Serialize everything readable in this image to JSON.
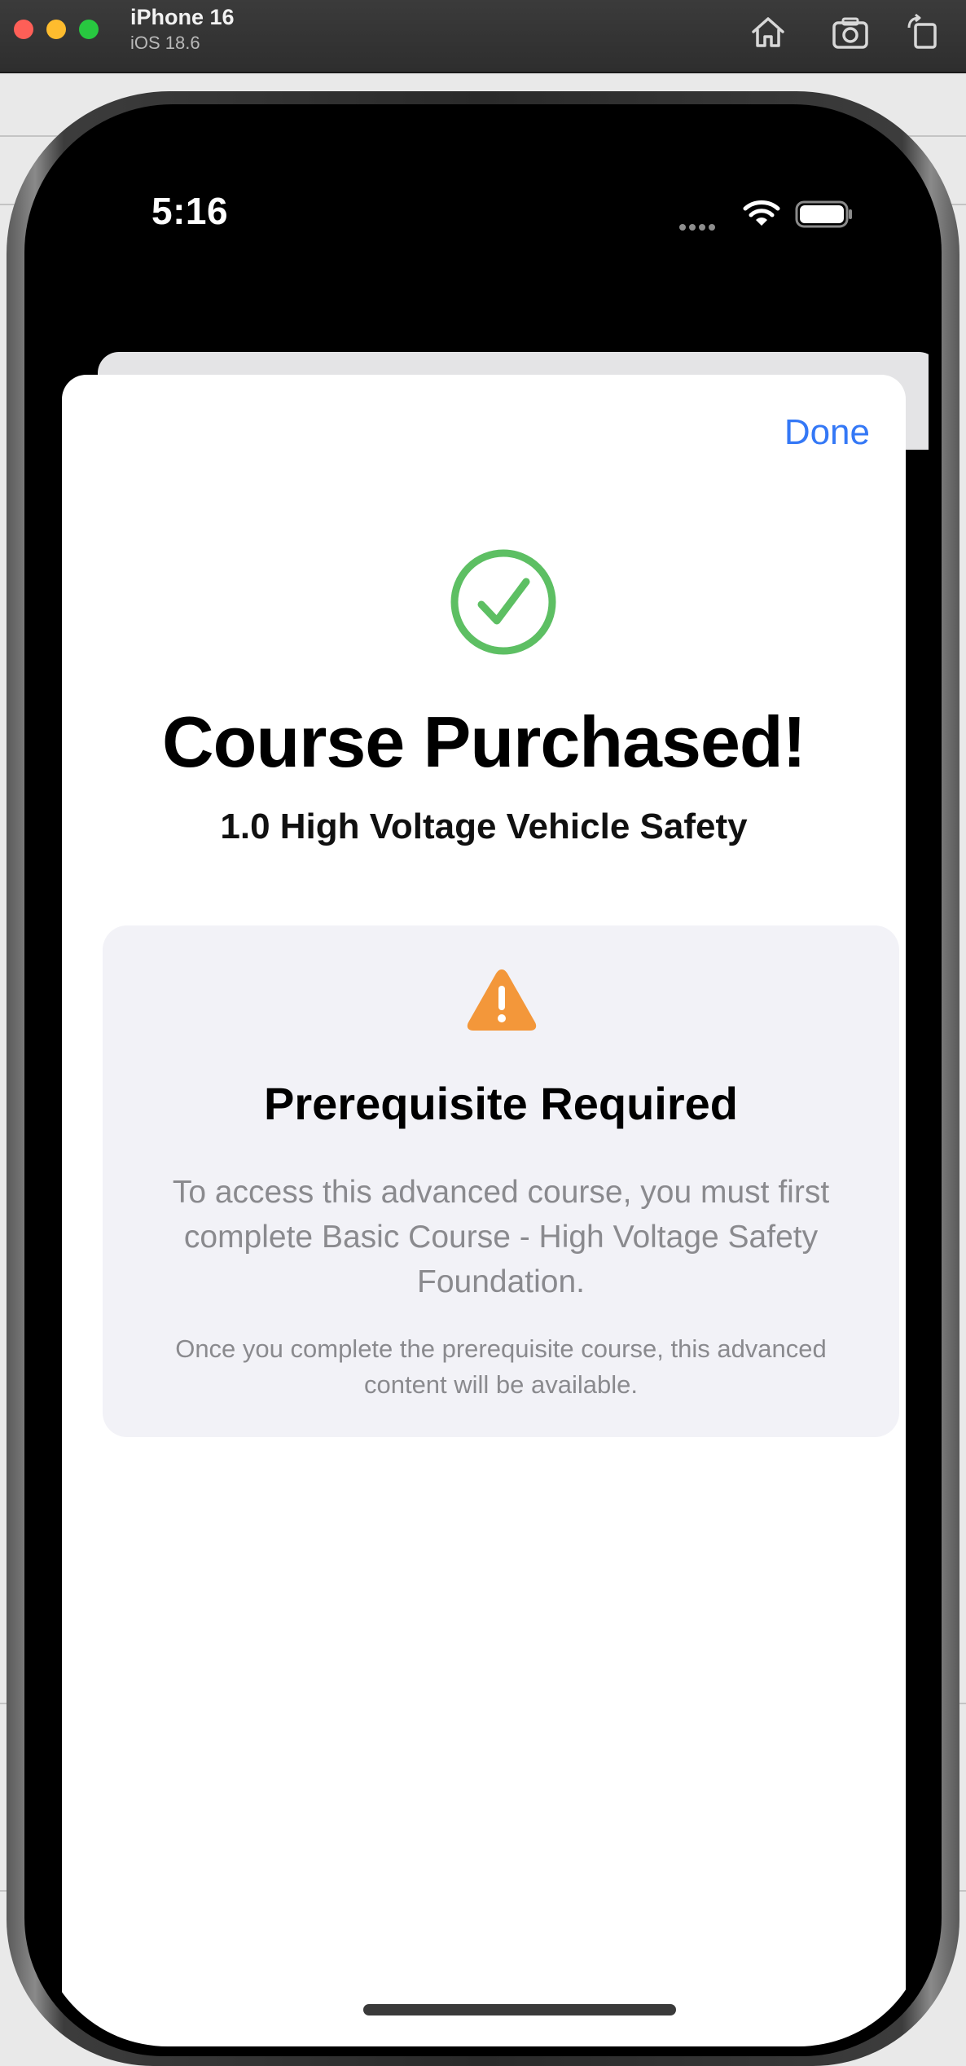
{
  "simulator": {
    "device_name": "iPhone 16",
    "os_version": "iOS 18.6",
    "toolbar_icons": [
      "home-icon",
      "screenshot-icon",
      "rotate-icon"
    ]
  },
  "status_bar": {
    "time": "5:16",
    "icons": [
      "cellular-icon",
      "wifi-icon",
      "battery-icon"
    ]
  },
  "sheet": {
    "done_label": "Done",
    "icon": "checkmark-circle-icon",
    "headline": "Course Purchased!",
    "course_title": "1.0 High Voltage Vehicle Safety"
  },
  "prerequisite": {
    "icon": "warning-triangle-icon",
    "title": "Prerequisite Required",
    "body": "To access this advanced course, you must first complete Basic Course - High Voltage Safety Foundation.",
    "note": "Once you complete the prerequisite course, this advanced content will be available."
  },
  "colors": {
    "accent": "#3478f6",
    "success": "#5dbf63",
    "warning": "#f3973a",
    "card_background": "#f2f2f7",
    "secondary_text": "#8a8a8e"
  }
}
